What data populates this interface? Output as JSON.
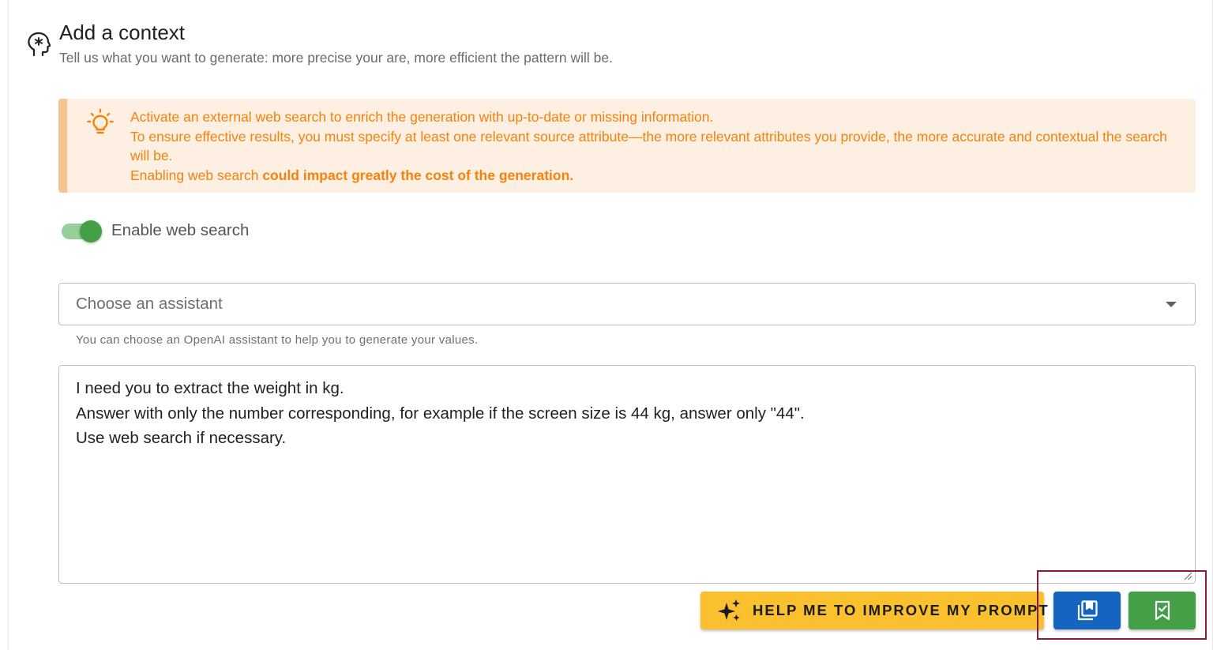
{
  "header": {
    "title": "Add a context",
    "subtitle": "Tell us what you want to generate: more precise your are, more efficient the pattern will be.",
    "icon": "head-brain-icon"
  },
  "alert": {
    "icon": "lightbulb-icon",
    "line1": "Activate an external web search to enrich the generation with up-to-date or missing information.",
    "line2": "To ensure effective results, you must specify at least one relevant source attribute—the more relevant attributes you provide, the more accurate and contextual the search will be.",
    "line3_prefix": "Enabling web search ",
    "line3_bold": "could impact greatly the cost of the generation.",
    "color": "#f5820d",
    "background": "#fdefe1"
  },
  "web_search": {
    "label": "Enable web search",
    "enabled": true,
    "color": "#43a047"
  },
  "assistant_select": {
    "placeholder": "Choose an assistant",
    "helper": "You can choose an OpenAI assistant to help you to generate your values."
  },
  "prompt": {
    "lines": [
      "I need you to extract the weight in kg.",
      "Answer with only the number corresponding, for example if the screen size is 44 kg, answer only \"44\".",
      "Use web search if necessary."
    ]
  },
  "actions": {
    "improve_label": "HELP ME TO IMPROVE MY PROMPT",
    "improve_color": "#fbc02d",
    "library_icon": "prompt-library-icon",
    "library_color": "#1565c0",
    "save_icon": "bookmark-check-icon",
    "save_color": "#43a047"
  }
}
